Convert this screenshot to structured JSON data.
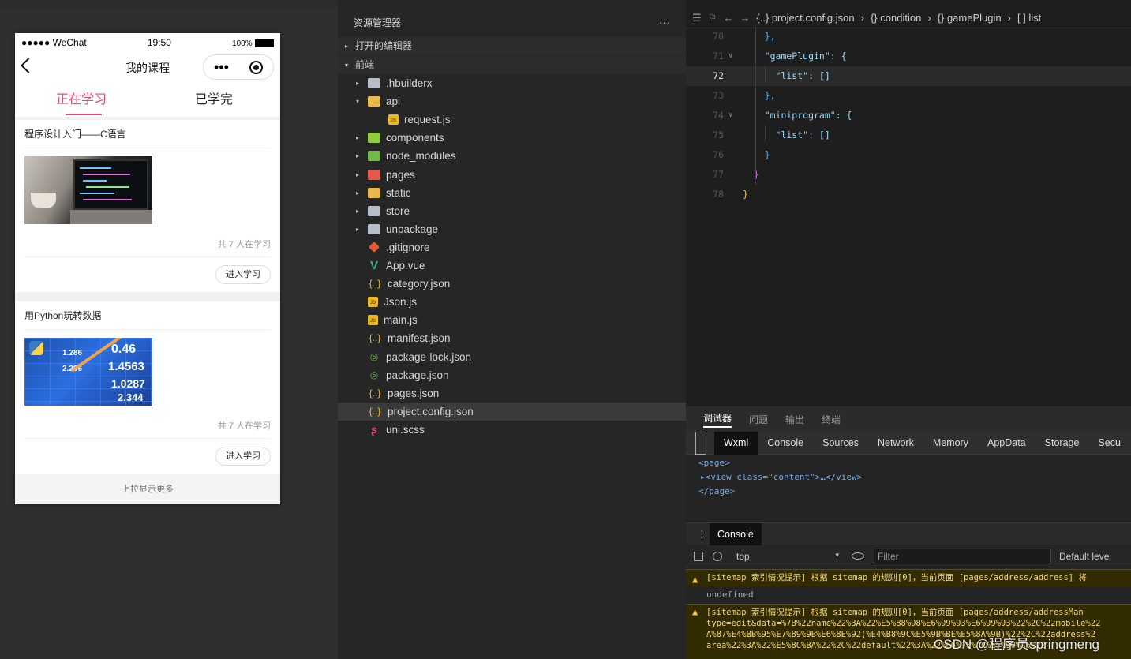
{
  "phone": {
    "status": {
      "carrier": "●●●●● WeChat",
      "time": "19:50",
      "battery": "100%"
    },
    "nav": {
      "title": "我的课程",
      "capsule_dots": "•••"
    },
    "tabs": [
      {
        "label": "正在学习",
        "active": true
      },
      {
        "label": "已学完",
        "active": false
      }
    ],
    "courses": [
      {
        "title": "程序设计入门——C语言",
        "learners": "共 7 人在学习",
        "button": "进入学习"
      },
      {
        "title": "用Python玩转数据",
        "learners": "共 7 人在学习",
        "button": "进入学习"
      }
    ],
    "thumb2_numbers": [
      "1.286",
      "2.286",
      "0.46",
      "1.4563",
      "1.0287",
      "2.344"
    ],
    "load_more": "上拉显示更多"
  },
  "explorer": {
    "title": "资源管理器",
    "more": "···",
    "sections": [
      "打开的编辑器",
      "前端"
    ],
    "files": [
      {
        "name": ".hbuilderx",
        "icon": "folder-icon",
        "twisty": "▸"
      },
      {
        "name": "api",
        "icon": "folder-open-icon",
        "twisty": "▾"
      },
      {
        "name": "request.js",
        "icon": "js-file-icon",
        "twisty": ""
      },
      {
        "name": "components",
        "icon": "components-folder-icon",
        "twisty": "▸"
      },
      {
        "name": "node_modules",
        "icon": "node-modules-folder-icon",
        "twisty": "▸"
      },
      {
        "name": "pages",
        "icon": "pages-folder-icon",
        "twisty": "▸"
      },
      {
        "name": "static",
        "icon": "static-folder-icon",
        "twisty": "▸"
      },
      {
        "name": "store",
        "icon": "folder-icon",
        "twisty": "▸"
      },
      {
        "name": "unpackage",
        "icon": "folder-icon",
        "twisty": "▸"
      },
      {
        "name": ".gitignore",
        "icon": "git-icon",
        "twisty": ""
      },
      {
        "name": "App.vue",
        "icon": "vue-icon",
        "twisty": ""
      },
      {
        "name": "category.json",
        "icon": "json-icon",
        "twisty": ""
      },
      {
        "name": "Json.js",
        "icon": "js-file-icon",
        "twisty": ""
      },
      {
        "name": "main.js",
        "icon": "js-file-icon",
        "twisty": ""
      },
      {
        "name": "manifest.json",
        "icon": "json-icon",
        "twisty": ""
      },
      {
        "name": "package-lock.json",
        "icon": "package-icon",
        "twisty": ""
      },
      {
        "name": "package.json",
        "icon": "package-icon",
        "twisty": ""
      },
      {
        "name": "pages.json",
        "icon": "json-icon",
        "twisty": ""
      },
      {
        "name": "project.config.json",
        "icon": "json-icon",
        "twisty": "",
        "selected": true
      },
      {
        "name": "uni.scss",
        "icon": "scss-icon",
        "twisty": ""
      }
    ]
  },
  "editor": {
    "breadcrumb": [
      "{..} project.config.json",
      "{} condition",
      "{} gamePlugin",
      "[ ] list"
    ],
    "lines": [
      {
        "n": "70",
        "text": "    },"
      },
      {
        "n": "71",
        "text": "    \"gamePlugin\": {"
      },
      {
        "n": "72",
        "text": "      \"list\": []"
      },
      {
        "n": "73",
        "text": "    },"
      },
      {
        "n": "74",
        "text": "    \"miniprogram\": {"
      },
      {
        "n": "75",
        "text": "      \"list\": []"
      },
      {
        "n": "76",
        "text": "    }"
      },
      {
        "n": "77",
        "text": "  }"
      },
      {
        "n": "78",
        "text": "}"
      }
    ]
  },
  "devtools": {
    "panel_tabs": [
      "调试器",
      "问题",
      "输出",
      "终端"
    ],
    "tabs": [
      "Wxml",
      "Console",
      "Sources",
      "Network",
      "Memory",
      "AppData",
      "Storage",
      "Secu"
    ],
    "wxml": [
      "<page>",
      "▸<view class=\"content\">…</view>",
      "</page>"
    ],
    "console_tab": "Console",
    "context": "top",
    "context_arrow": "▾",
    "filter_placeholder": "Filter",
    "levels": "Default leve",
    "logs": [
      "[sitemap 索引情况提示] 根据 sitemap 的规则[0]，当前页面 [pages/address/address] 将",
      "undefined",
      "[sitemap 索引情况提示] 根据 sitemap 的规则[0]，当前页面 [pages/address/addressMan",
      "type=edit&data=%7B%22name%22%3A%22%E5%88%98%E6%99%93%E6%99%93%22%2C%22mobile%22",
      "A%87%E4%BB%95%E7%89%9B%E6%8E%92(%E4%B8%9C%E5%9B%BE%E5%8A%9B)%22%2C%22address%2",
      "area%22%3A%22%E5%8C%BA%22%2C%22default%22%3A%22%E6%98%AF%E5%90%A6%22"
    ]
  },
  "watermark": "CSDN @程序员springmeng"
}
